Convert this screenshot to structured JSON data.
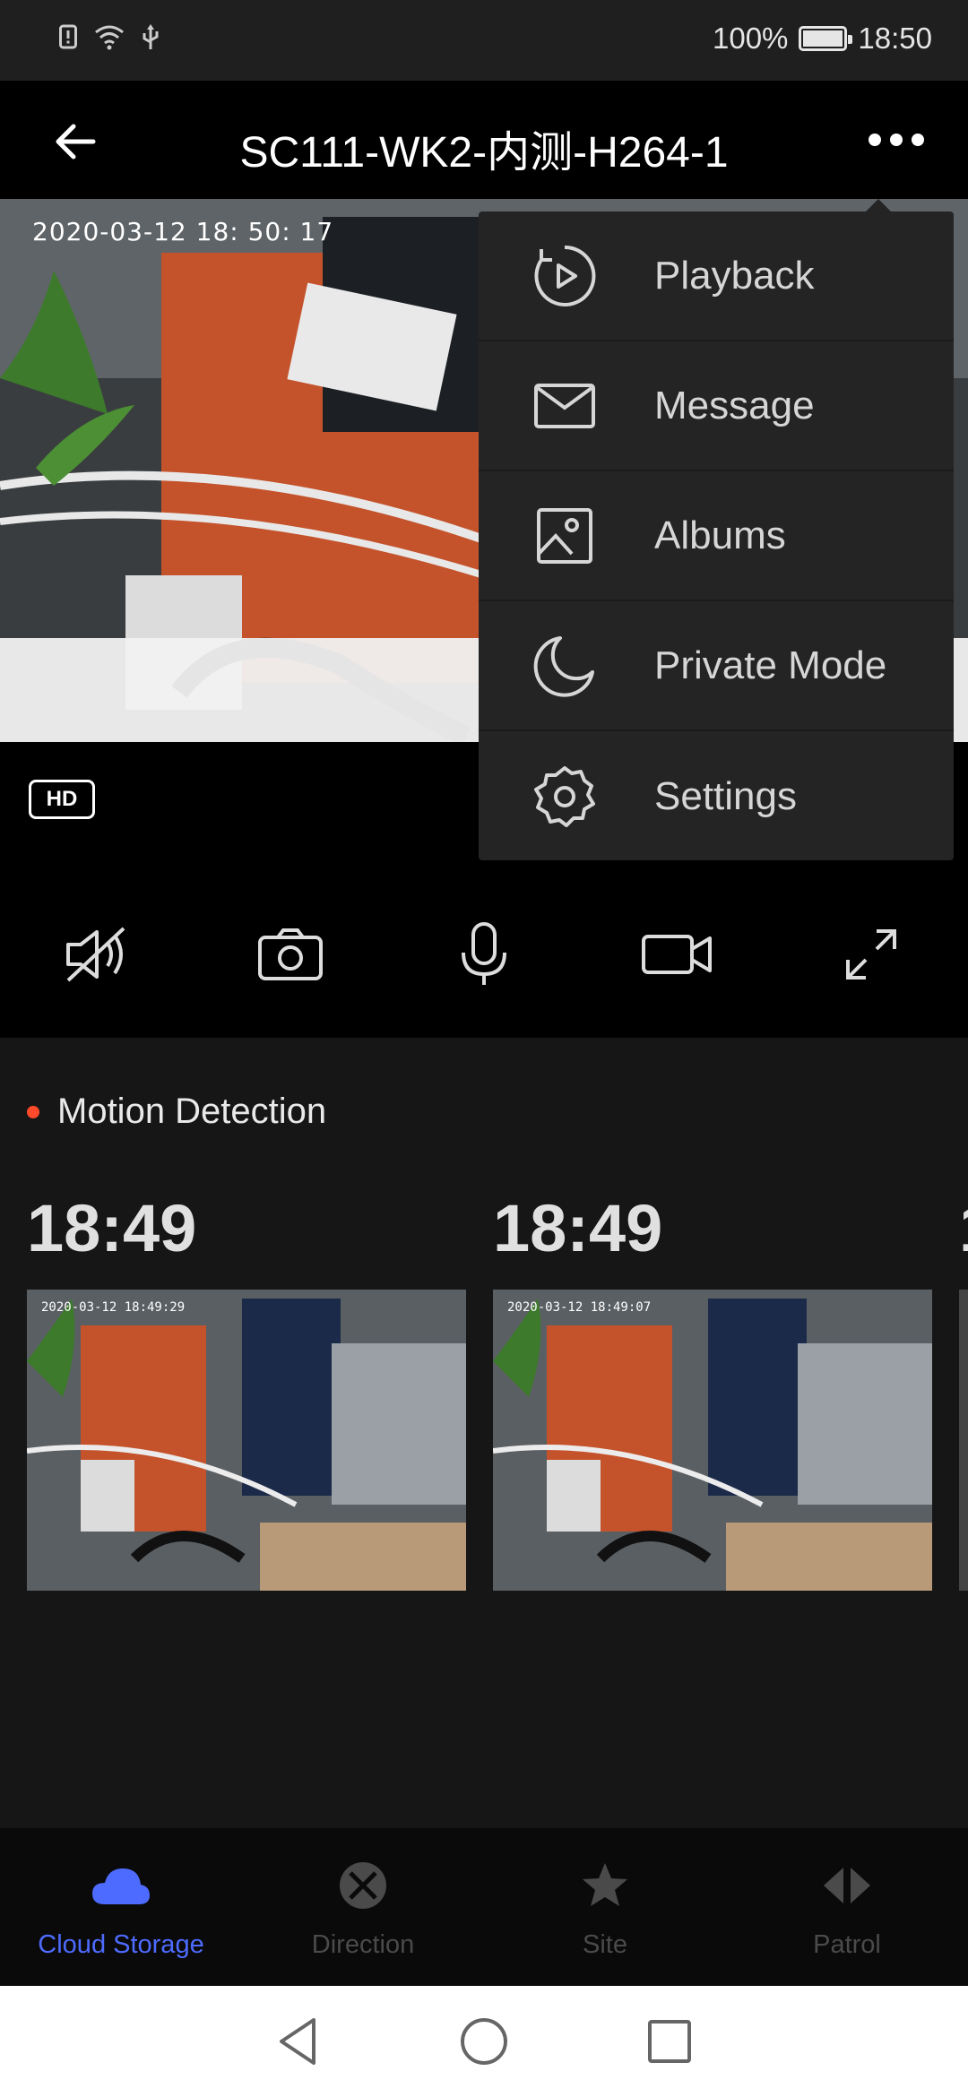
{
  "status_bar": {
    "battery": "100%",
    "time": "18:50"
  },
  "app_bar": {
    "title": "SC111-WK2-内测-H264-1"
  },
  "video": {
    "timestamp": "2020-03-12   18: 50: 17",
    "quality_badge": "HD"
  },
  "controls": [
    {
      "name": "mute",
      "icon": "speaker-muted-icon"
    },
    {
      "name": "snapshot",
      "icon": "camera-icon"
    },
    {
      "name": "talk",
      "icon": "microphone-icon"
    },
    {
      "name": "record",
      "icon": "video-camera-icon"
    },
    {
      "name": "fullscreen",
      "icon": "expand-icon"
    }
  ],
  "motion_section": {
    "title": "Motion Detection",
    "events": [
      {
        "time": "18:49",
        "thumb_timestamp": "2020-03-12  18:49:29"
      },
      {
        "time": "18:49",
        "thumb_timestamp": "2020-03-12  18:49:07"
      }
    ]
  },
  "menu": {
    "items": [
      {
        "label": "Playback",
        "icon": "playback-icon"
      },
      {
        "label": "Message",
        "icon": "envelope-icon"
      },
      {
        "label": "Albums",
        "icon": "image-icon"
      },
      {
        "label": "Private Mode",
        "icon": "moon-icon"
      },
      {
        "label": "Settings",
        "icon": "gear-icon"
      }
    ]
  },
  "tabs": [
    {
      "label": "Cloud Storage",
      "active": true,
      "icon": "cloud-icon"
    },
    {
      "label": "Direction",
      "active": false,
      "icon": "direction-icon"
    },
    {
      "label": "Site",
      "active": false,
      "icon": "star-icon"
    },
    {
      "label": "Patrol",
      "active": false,
      "icon": "patrol-icon"
    }
  ],
  "colors": {
    "accent": "#4e6bff",
    "record_dot": "#ff4a2b",
    "menu_bg": "#242424"
  }
}
